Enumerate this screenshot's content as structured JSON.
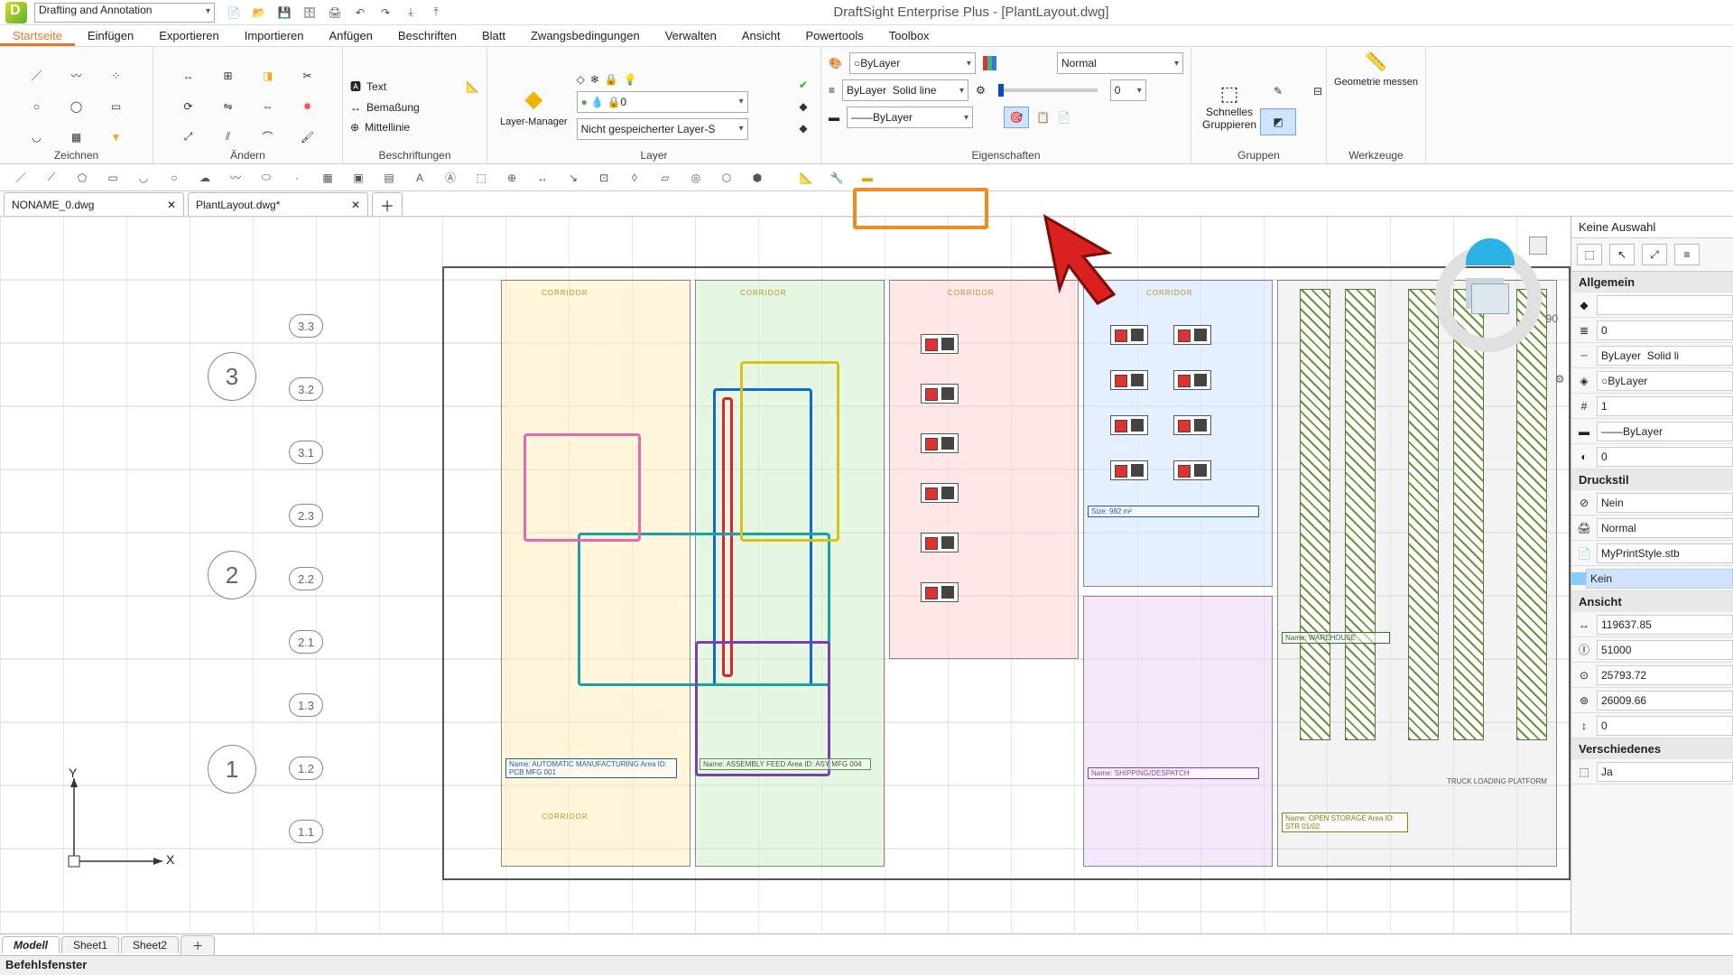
{
  "title": "DraftSight Enterprise Plus - [PlantLayout.dwg]",
  "workspace": "Drafting and Annotation",
  "qat": [
    "new",
    "open",
    "save",
    "saveas",
    "print",
    "undo",
    "redo",
    "export",
    "import"
  ],
  "ribbon_tabs": [
    "Startseite",
    "Einfügen",
    "Exportieren",
    "Importieren",
    "Anfügen",
    "Beschriften",
    "Blatt",
    "Zwangsbedingungen",
    "Verwalten",
    "Ansicht",
    "Powertools",
    "Toolbox"
  ],
  "ribbon_tabs_active": 0,
  "panels": {
    "draw": "Zeichnen",
    "modify": "Ändern",
    "annotate": "Beschriftungen",
    "layer": "Layer",
    "layer_manager": "Layer-Manager",
    "layer_unsaved": "Nicht gespeicherter Layer-S",
    "layer_zero": "0",
    "props": "Eigenschaften",
    "props_bylayer": "ByLayer",
    "props_solid": "Solid line",
    "props_normal": "Normal",
    "props_zero": "0",
    "groups": "Gruppen",
    "groups_quick": "Schnelles Gruppieren",
    "tools": "Werkzeuge",
    "tools_meas": "Geometrie messen"
  },
  "annotate_items": {
    "text": "Text",
    "dim": "Bemaßung",
    "center": "Mittellinie"
  },
  "doc_tabs": [
    "NONAME_0.dwg",
    "PlantLayout.dwg*"
  ],
  "doc_tabs_active": 1,
  "bottom_tabs": [
    "Modell",
    "Sheet1",
    "Sheet2"
  ],
  "bottom_tabs_active": 0,
  "cmd_title": "Befehlsfenster",
  "viewcube_angle": "90",
  "axis_labels": {
    "primary": [
      "1",
      "2",
      "3"
    ],
    "secondary": [
      "1.1",
      "1.2",
      "1.3",
      "2.1",
      "2.2",
      "2.3",
      "3.1",
      "3.2",
      "3.3"
    ]
  },
  "corridors": [
    "CORRIDOR",
    "CORRIDOR",
    "CORRIDOR",
    "CORRIDOR",
    "CORRIDOR"
  ],
  "zone_labels": {
    "z1a": "Name: AUTOMATIC MANUFACTURING  Area ID: PCB MFG 001",
    "z2a": "Name: ASSEMBLY FEED  Area ID: ASY MFG 004",
    "z4a": "Size: 982 m²",
    "z5a": "Name: SHIPPING/DESPATCH",
    "z6a": "Name: WAREHOUSE",
    "z6b": "Name: OPEN STORAGE  Area ID: STR 01/02",
    "truck": "TRUCK LOADING PLATFORM"
  },
  "props_panel": {
    "no_sel": "Keine Auswahl",
    "general": "Allgemein",
    "g_layer": "0",
    "g_ltype": "ByLayer",
    "g_solid": "Solid li",
    "g_color": "ByLayer",
    "g_one": "1",
    "g_lw": "ByLayer",
    "g_zero": "0",
    "plot": "Druckstil",
    "p_no": "Nein",
    "p_normal": "Normal",
    "p_style": "MyPrintStyle.stb",
    "p_none": "Kein",
    "view": "Ansicht",
    "v_a": "119637.85",
    "v_b": "51000",
    "v_c": "25793.72",
    "v_d": "26009.66",
    "v_e": "0",
    "misc": "Verschiedenes",
    "m_yes": "Ja"
  }
}
